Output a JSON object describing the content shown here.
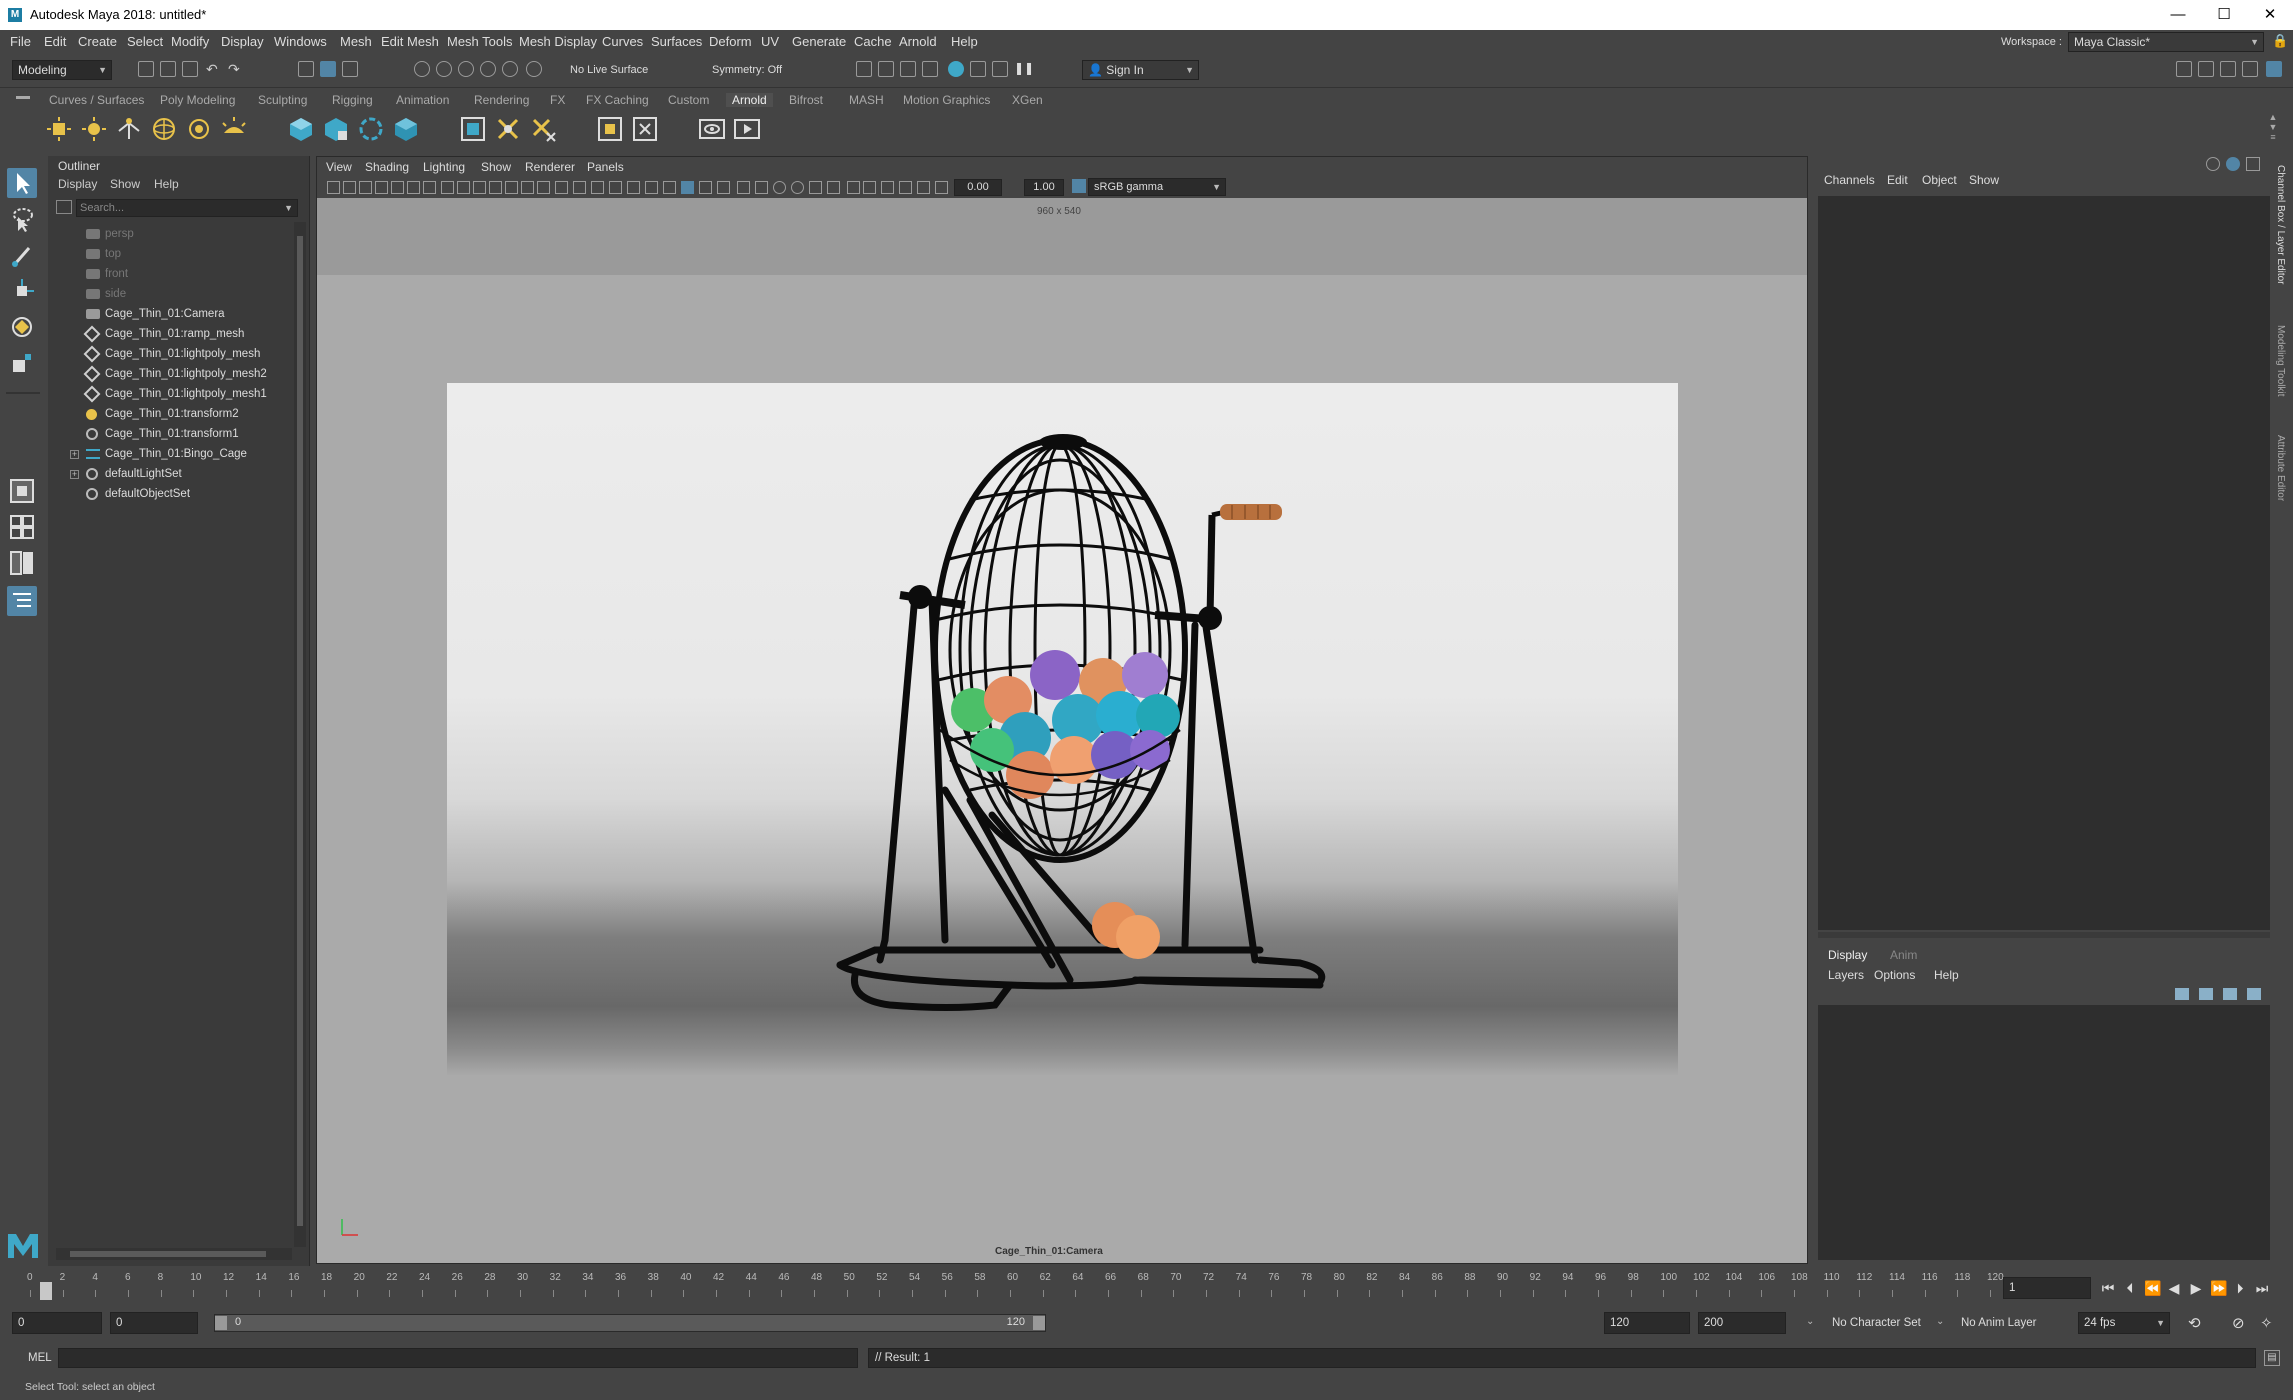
{
  "window": {
    "title": "Autodesk Maya 2018: untitled*",
    "minimize": "—",
    "maximize": "☐",
    "close": "✕"
  },
  "menu": [
    "File",
    "Edit",
    "Create",
    "Select",
    "Modify",
    "Display",
    "Windows",
    "Mesh",
    "Edit Mesh",
    "Mesh Tools",
    "Mesh Display",
    "Curves",
    "Surfaces",
    "Deform",
    "UV",
    "Generate",
    "Cache",
    "Arnold",
    "Help"
  ],
  "workspace": {
    "label": "Workspace :",
    "value": "Maya Classic*"
  },
  "statusline": {
    "mode": "Modeling",
    "live_surface": "No Live Surface",
    "symmetry": "Symmetry: Off",
    "sign_in": "Sign In"
  },
  "shelf_tabs": [
    "Curves / Surfaces",
    "Poly Modeling",
    "Sculpting",
    "Rigging",
    "Animation",
    "Rendering",
    "FX",
    "FX Caching",
    "Custom",
    "Arnold",
    "Bifrost",
    "MASH",
    "Motion Graphics",
    "XGen"
  ],
  "shelf_active": "Arnold",
  "outliner": {
    "title": "Outliner",
    "menu": [
      "Display",
      "Show",
      "Help"
    ],
    "search_placeholder": "Search...",
    "items": [
      {
        "label": "persp",
        "type": "camera",
        "dim": true
      },
      {
        "label": "top",
        "type": "camera",
        "dim": true
      },
      {
        "label": "front",
        "type": "camera",
        "dim": true
      },
      {
        "label": "side",
        "type": "camera",
        "dim": true
      },
      {
        "label": "Cage_Thin_01:Camera",
        "type": "camera",
        "dim": false
      },
      {
        "label": "Cage_Thin_01:ramp_mesh",
        "type": "mesh",
        "dim": false
      },
      {
        "label": "Cage_Thin_01:lightpoly_mesh",
        "type": "mesh",
        "dim": false
      },
      {
        "label": "Cage_Thin_01:lightpoly_mesh2",
        "type": "mesh",
        "dim": false
      },
      {
        "label": "Cage_Thin_01:lightpoly_mesh1",
        "type": "mesh",
        "dim": false
      },
      {
        "label": "Cage_Thin_01:transform2",
        "type": "light",
        "dim": false
      },
      {
        "label": "Cage_Thin_01:transform1",
        "type": "transform",
        "dim": false
      },
      {
        "label": "Cage_Thin_01:Bingo_Cage",
        "type": "joint",
        "dim": false,
        "expandable": true
      },
      {
        "label": "defaultLightSet",
        "type": "set",
        "dim": false,
        "expandable": true
      },
      {
        "label": "defaultObjectSet",
        "type": "set",
        "dim": false
      }
    ]
  },
  "viewport": {
    "menu": [
      "View",
      "Shading",
      "Lighting",
      "Show",
      "Renderer",
      "Panels"
    ],
    "exposure": "0.00",
    "gamma": "1.00",
    "color_space": "sRGB gamma",
    "resolution": "960 x 540",
    "camera_label": "Cage_Thin_01:Camera"
  },
  "channel_box": {
    "menu": [
      "Channels",
      "Edit",
      "Object",
      "Show"
    ],
    "side_tabs": [
      "Channel Box / Layer Editor",
      "Modeling Toolkit",
      "Attribute Editor"
    ]
  },
  "layer_editor": {
    "tabs": [
      "Display",
      "Anim"
    ],
    "menu": [
      "Layers",
      "Options",
      "Help"
    ]
  },
  "timeline": {
    "ticks": [
      "0",
      "2",
      "4",
      "6",
      "8",
      "10",
      "12",
      "14",
      "16",
      "18",
      "20",
      "22",
      "24",
      "26",
      "28",
      "30",
      "32",
      "34",
      "36",
      "38",
      "40",
      "42",
      "44",
      "46",
      "48",
      "50",
      "52",
      "54",
      "56",
      "58",
      "60",
      "62",
      "64",
      "66",
      "68",
      "70",
      "72",
      "74",
      "76",
      "78",
      "80",
      "82",
      "84",
      "86",
      "88",
      "90",
      "92",
      "94",
      "96",
      "98",
      "100",
      "102",
      "104",
      "106",
      "108",
      "110",
      "112",
      "114",
      "116",
      "118",
      "120"
    ],
    "min": 0,
    "max": 120,
    "current_frame": 1,
    "current_frame_field": "1"
  },
  "range": {
    "start": "0",
    "anim_start": "0",
    "range_start_label": "0",
    "range_end_label": "120",
    "end": "120",
    "anim_end": "200",
    "character_set": "No Character Set",
    "anim_layer": "No Anim Layer",
    "fps": "24 fps"
  },
  "command": {
    "lang": "MEL",
    "result": "// Result: 1"
  },
  "help_line": "Select Tool: select an object",
  "colors": {
    "accent": "#5285a6",
    "panel": "#444444",
    "dark": "#2b2b2b"
  }
}
